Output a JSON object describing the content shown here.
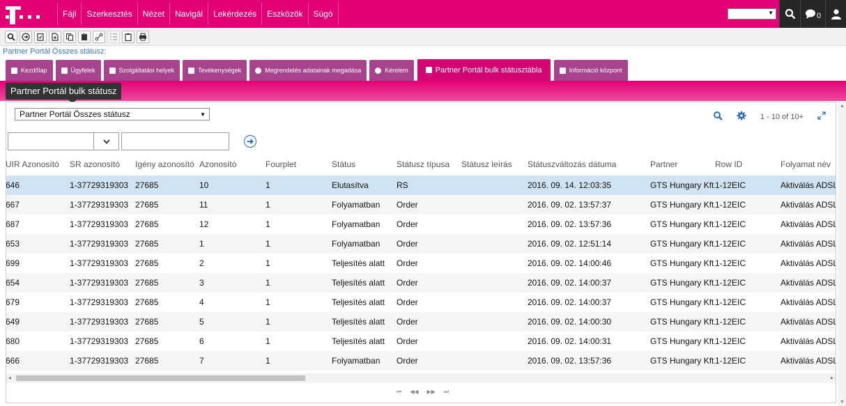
{
  "menu": [
    "Fájl",
    "Szerkesztés",
    "Nézet",
    "Navigál",
    "Lekérdezés",
    "Eszközök",
    "Súgó"
  ],
  "top_icons": [
    "search-icon",
    "chat-icon",
    "user-icon"
  ],
  "notification_count": "0",
  "toolbar_icons": [
    "search-icon",
    "go-icon",
    "checklist-icon",
    "new-record-icon",
    "copy-record-icon",
    "paste-icon",
    "link-icon",
    "list-icon",
    "clipboard-icon",
    "print-icon"
  ],
  "breadcrumb": "Partner Portál Összes státusz:",
  "tabs": [
    {
      "label": "Kezdőlap",
      "icon": "doc-icon"
    },
    {
      "label": "Ügyfelek",
      "icon": "people-icon"
    },
    {
      "label": "Szolgáltatási helyek",
      "icon": "doc-icon"
    },
    {
      "label": "Tevékenységek",
      "icon": "doc-icon"
    },
    {
      "label": "Megrendelés adatainak megadása",
      "icon": "refresh-icon"
    },
    {
      "label": "Kérelem",
      "icon": "check-icon"
    },
    {
      "label": "Partner Portál bulk státusztábla",
      "icon": "doc-icon",
      "active": true
    },
    {
      "label": "Információ központ",
      "icon": "doc-icon"
    }
  ],
  "section_title": "Partner Portál bulk státusz",
  "query": {
    "selected": "Partner Portál Összes státusz"
  },
  "record_count": "1 - 10 of 10+",
  "columns": [
    "UIR Azonosító",
    "SR azonosító",
    "Igény azonosító",
    "Azonosító",
    "Fourplet",
    "Státus",
    "Státusz típusa",
    "Státusz leírás",
    "Státuszváltozás dátuma",
    "Partner",
    "Row ID",
    "Folyamat név"
  ],
  "rows": [
    [
      "646",
      "1-37729319303",
      "27685",
      "10",
      "1",
      "Elutasítva",
      "RS",
      "",
      "2016. 09. 14. 12:03:35",
      "GTS Hungary Kft.",
      "1-12EIC",
      "Aktiválás ADSL"
    ],
    [
      "667",
      "1-37729319303",
      "27685",
      "11",
      "1",
      "Folyamatban",
      "Order",
      "",
      "2016. 09. 02. 13:57:37",
      "GTS Hungary Kft.",
      "1-12EIC",
      "Aktiválás ADSL"
    ],
    [
      "687",
      "1-37729319303",
      "27685",
      "12",
      "1",
      "Folyamatban",
      "Order",
      "",
      "2016. 09. 02. 13:57:36",
      "GTS Hungary Kft.",
      "1-12EIC",
      "Aktiválás ADSL"
    ],
    [
      "653",
      "1-37729319303",
      "27685",
      "1",
      "1",
      "Folyamatban",
      "Order",
      "",
      "2016. 09. 02. 12:51:14",
      "GTS Hungary Kft.",
      "1-12EIC",
      "Aktiválás ADSL"
    ],
    [
      "699",
      "1-37729319303",
      "27685",
      "2",
      "1",
      "Teljesítés alatt",
      "Order",
      "",
      "2016. 09. 02. 14:00:46",
      "GTS Hungary Kft.",
      "1-12EIC",
      "Aktiválás ADSL"
    ],
    [
      "654",
      "1-37729319303",
      "27685",
      "3",
      "1",
      "Teljesítés alatt",
      "Order",
      "",
      "2016. 09. 02. 14:00:37",
      "GTS Hungary Kft.",
      "1-12EIC",
      "Aktiválás ADSL"
    ],
    [
      "679",
      "1-37729319303",
      "27685",
      "4",
      "1",
      "Teljesítés alatt",
      "Order",
      "",
      "2016. 09. 02. 14:00:37",
      "GTS Hungary Kft.",
      "1-12EIC",
      "Aktiválás ADSL"
    ],
    [
      "649",
      "1-37729319303",
      "27685",
      "5",
      "1",
      "Teljesítés alatt",
      "Order",
      "",
      "2016. 09. 02. 14:00:30",
      "GTS Hungary Kft.",
      "1-12EIC",
      "Aktiválás ADSL"
    ],
    [
      "680",
      "1-37729319303",
      "27685",
      "6",
      "1",
      "Teljesítés alatt",
      "Order",
      "",
      "2016. 09. 02. 14:00:31",
      "GTS Hungary Kft.",
      "1-12EIC",
      "Aktiválás ADSL"
    ],
    [
      "666",
      "1-37729319303",
      "27685",
      "7",
      "1",
      "Folyamatban",
      "Order",
      "",
      "2016. 09. 02. 13:57:36",
      "GTS Hungary Kft.",
      "1-12EIC",
      "Aktiválás ADSL"
    ]
  ],
  "selected_row": 0,
  "colors": {
    "brand": "#e20074",
    "tab": "#a7428c",
    "selection": "#cfe3f2"
  }
}
